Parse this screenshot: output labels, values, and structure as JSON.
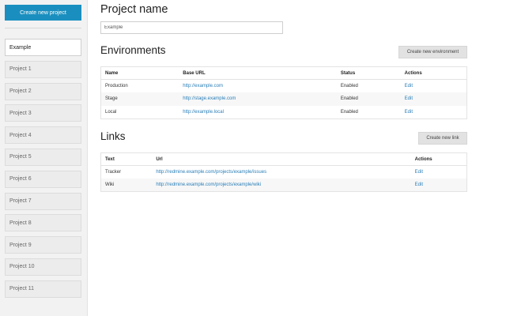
{
  "sidebar": {
    "create_button": "Create new project",
    "projects": [
      {
        "label": "Example",
        "active": true
      },
      {
        "label": "Project 1"
      },
      {
        "label": "Project 2"
      },
      {
        "label": "Project 3"
      },
      {
        "label": "Project 4"
      },
      {
        "label": "Project 5"
      },
      {
        "label": "Project 6"
      },
      {
        "label": "Project 7"
      },
      {
        "label": "Project 8"
      },
      {
        "label": "Project 9"
      },
      {
        "label": "Project 10"
      },
      {
        "label": "Project 11"
      }
    ]
  },
  "main": {
    "title": "Project name",
    "name_value": "Example",
    "environments": {
      "title": "Environments",
      "create_button": "Create new environment",
      "headers": [
        "Name",
        "Base URL",
        "Status",
        "Actions"
      ],
      "rows": [
        {
          "name": "Production",
          "url": "http://example.com",
          "status": "Enabled",
          "action": "Edit"
        },
        {
          "name": "Stage",
          "url": "http://stage.example.com",
          "status": "Enabled",
          "action": "Edit"
        },
        {
          "name": "Local",
          "url": "http://example.local",
          "status": "Enabled",
          "action": "Edit"
        }
      ]
    },
    "links": {
      "title": "Links",
      "create_button": "Create new link",
      "headers": [
        "Text",
        "Url",
        "Actions"
      ],
      "rows": [
        {
          "text": "Tracker",
          "url": "http://redmine.example.com/projects/example/issues",
          "action": "Edit"
        },
        {
          "text": "Wiki",
          "url": "http://redmine.example.com/projects/example/wiki",
          "action": "Edit"
        }
      ]
    }
  }
}
